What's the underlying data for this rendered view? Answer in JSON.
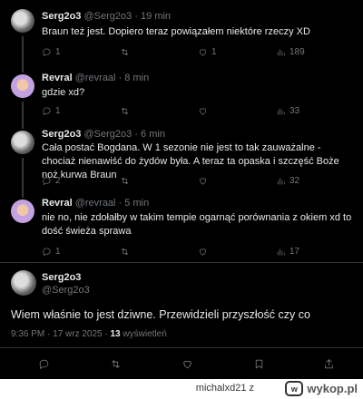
{
  "tweets": [
    {
      "name": "Serg2o3",
      "handle": "@Serg2o3",
      "time": "· 19 min",
      "text": "Braun też jest. Dopiero teraz powiązałem niektóre rzeczy XD",
      "replies": "1",
      "reposts": "",
      "likes": "1",
      "views": "189"
    },
    {
      "name": "Revral",
      "handle": "@revraal",
      "time": "· 8 min",
      "text": "gdzie xd?",
      "replies": "1",
      "reposts": "",
      "likes": "",
      "views": "33"
    },
    {
      "name": "Serg2o3",
      "handle": "@Serg2o3",
      "time": "· 6 min",
      "text": "Cała postać Bogdana. W 1 sezonie nie jest to tak zauważalne - chociaż nienawiść do żydów była. A teraz ta opaska i szczęść Boże noż kurwa Braun",
      "replies": "2",
      "reposts": "",
      "likes": "",
      "views": "32"
    },
    {
      "name": "Revral",
      "handle": "@revraal",
      "time": "· 5 min",
      "text": "nie no, nie zdołałby w takim tempie ogarnąć porównania z okiem xd to dość świeża sprawa",
      "replies": "1",
      "reposts": "",
      "likes": "",
      "views": "17"
    }
  ],
  "main": {
    "name": "Serg2o3",
    "handle": "@Serg2o3",
    "text": "Wiem właśnie to jest dziwne. Przewidzieli przyszłość czy co",
    "time": "9:36 PM · 17 wrz 2025 · ",
    "views_count": "13",
    "views_label": " wyświetleń"
  },
  "footer": {
    "user": "michalxd21",
    "suffix": "z",
    "brand": "wykop.pl",
    "logo_mark": "w"
  }
}
